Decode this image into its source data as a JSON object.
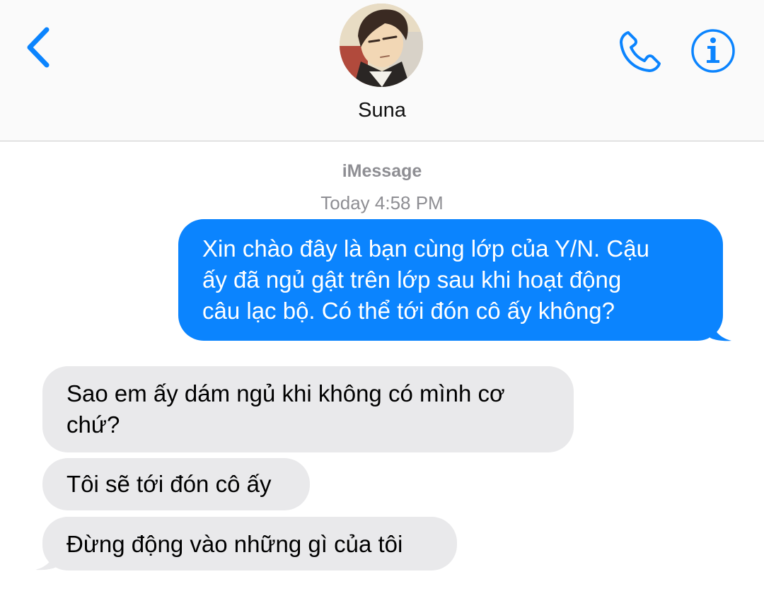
{
  "header": {
    "contact_name": "Suna",
    "back_icon": "chevron-left-icon",
    "call_icon": "phone-icon",
    "info_icon": "info-icon",
    "accent_color": "#0b84fe"
  },
  "thread": {
    "service_label": "iMessage",
    "timestamp": "Today 4:58 PM"
  },
  "messages": [
    {
      "direction": "outgoing",
      "lines": [
        "Xin chào đây là bạn cùng lớp của Y/N. Cậu",
        "ấy đã ngủ gật trên lớp sau khi hoạt động",
        "câu lạc bộ. Có thể tới đón cô ấy không?"
      ]
    },
    {
      "direction": "incoming",
      "lines": [
        "Sao em ấy dám ngủ khi không có mình cơ",
        "chứ?"
      ]
    },
    {
      "direction": "incoming",
      "lines": [
        "Tôi sẽ tới đón cô ấy"
      ]
    },
    {
      "direction": "incoming",
      "lines": [
        "Đừng động vào những gì của tôi"
      ]
    }
  ],
  "colors": {
    "outgoing_bubble": "#0b84fe",
    "incoming_bubble": "#e9e9eb",
    "meta_text": "#8e8e93"
  }
}
